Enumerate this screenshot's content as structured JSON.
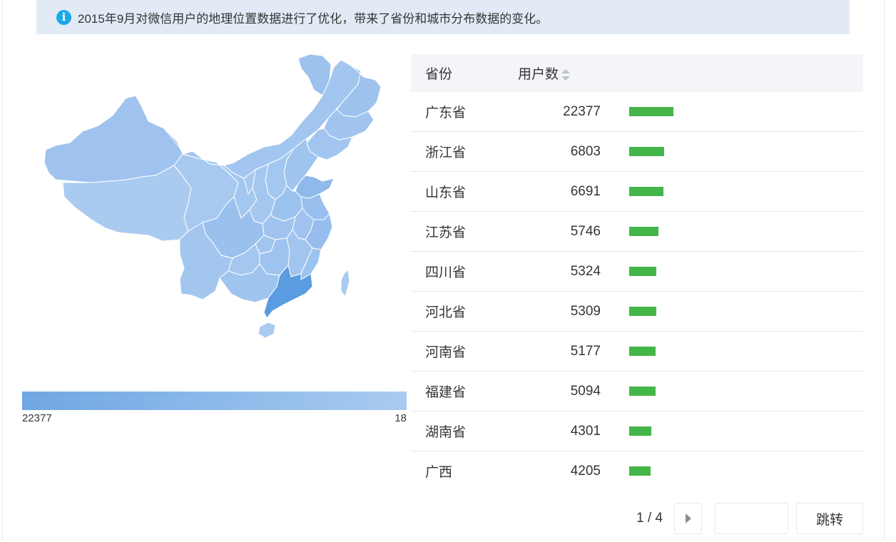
{
  "notice": {
    "icon": "info-icon",
    "text": "2015年9月对微信用户的地理位置数据进行了优化，带来了省份和城市分布数据的变化。"
  },
  "map": {
    "highlighted_province": "广东省",
    "colors": {
      "max": "#6fa7e3",
      "min": "#a9cbf0",
      "highlight": "#5b9ce0",
      "border": "#ffffff"
    }
  },
  "legend": {
    "max_label": "22377",
    "min_label": "18"
  },
  "table": {
    "headers": {
      "province": "省份",
      "users": "用户数"
    },
    "max_value": 22377,
    "rows": [
      {
        "province": "广东省",
        "users": "22377",
        "value": 22377
      },
      {
        "province": "浙江省",
        "users": "6803",
        "value": 6803
      },
      {
        "province": "山东省",
        "users": "6691",
        "value": 6691
      },
      {
        "province": "江苏省",
        "users": "5746",
        "value": 5746
      },
      {
        "province": "四川省",
        "users": "5324",
        "value": 5324
      },
      {
        "province": "河北省",
        "users": "5309",
        "value": 5309
      },
      {
        "province": "河南省",
        "users": "5177",
        "value": 5177
      },
      {
        "province": "福建省",
        "users": "5094",
        "value": 5094
      },
      {
        "province": "湖南省",
        "users": "4301",
        "value": 4301
      },
      {
        "province": "广西",
        "users": "4205",
        "value": 4205
      }
    ],
    "bar_color": "#44b549"
  },
  "pagination": {
    "page_info": "1 / 4",
    "next_icon": "triangle-right-icon",
    "jump_label": "跳转",
    "input_value": ""
  }
}
